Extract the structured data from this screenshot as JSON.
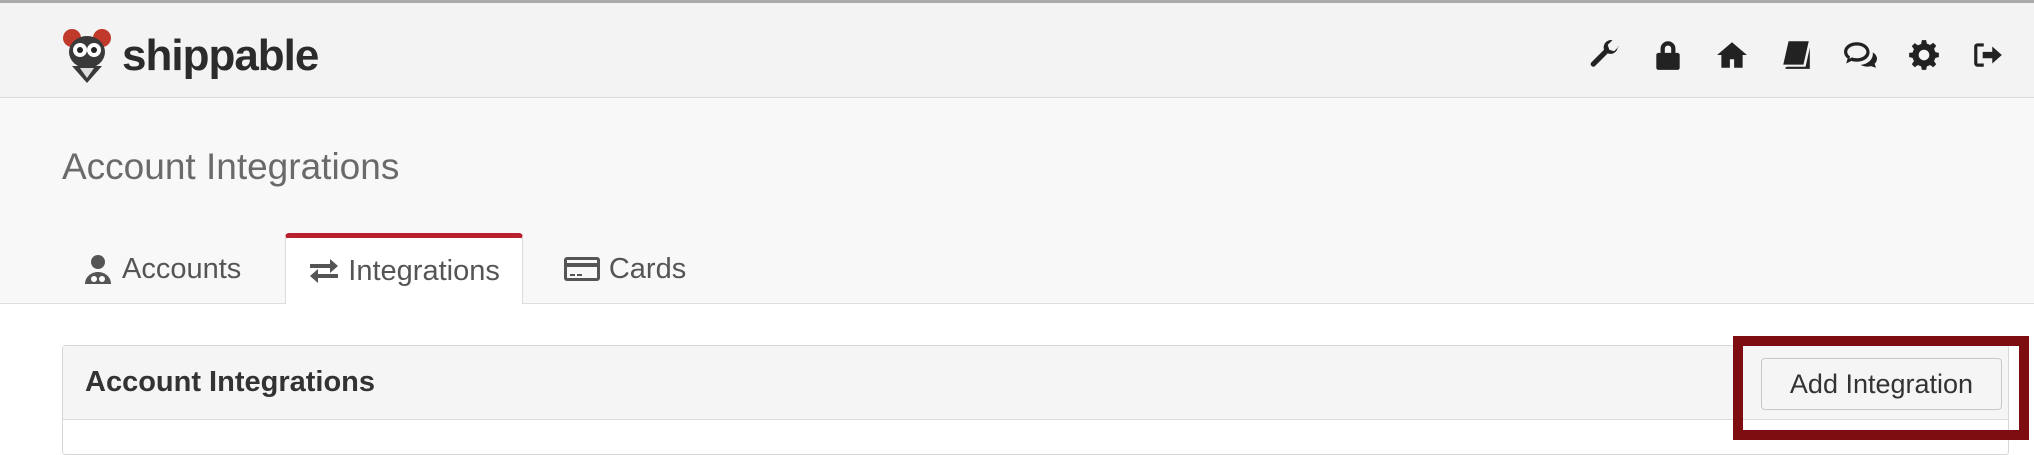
{
  "header": {
    "logo_text": "shippable",
    "icons": [
      "wrench-icon",
      "lock-icon",
      "home-icon",
      "book-icon",
      "chat-icon",
      "gear-icon",
      "sign-out-icon"
    ]
  },
  "page": {
    "title": "Account Integrations"
  },
  "tabs": [
    {
      "label": "Accounts",
      "icon": "user-icon",
      "active": false
    },
    {
      "label": "Integrations",
      "icon": "exchange-icon",
      "active": true
    },
    {
      "label": "Cards",
      "icon": "credit-card-icon",
      "active": false
    }
  ],
  "panel": {
    "title": "Account Integrations",
    "add_button_label": "Add Integration"
  },
  "colors": {
    "active_tab_accent": "#b9202e",
    "highlight_box": "#7d0d11"
  }
}
